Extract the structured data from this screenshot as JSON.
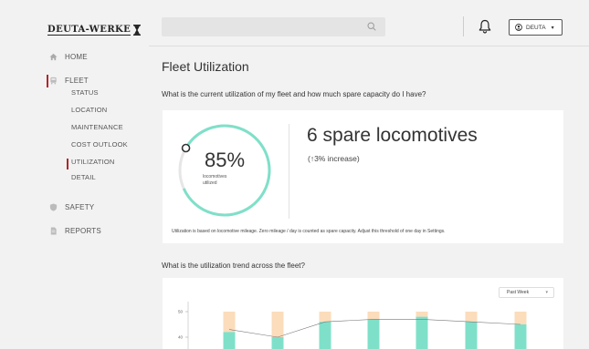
{
  "brand": {
    "name": "DEUTA-WERKE"
  },
  "nav": {
    "home": "HOME",
    "fleet": "FLEET",
    "fleet_sub": [
      "STATUS",
      "LOCATION",
      "MAINTENANCE",
      "COST OUTLOOK",
      "UTILIZATION",
      "DETAIL"
    ],
    "safety": "SAFETY",
    "reports": "REPORTS"
  },
  "topbar": {
    "search_placeholder": "",
    "user_label": "DEUTA"
  },
  "page": {
    "title": "Fleet Utilization",
    "question1": "What is the current utilization of my fleet and how much spare capacity do I have?",
    "utilization_pct": "85%",
    "utilization_value": 0.85,
    "utilization_caption": "locomotives utilized",
    "spare_headline": "6 spare locomotives",
    "spare_change": "(↑3% increase)",
    "note": "Utilization is based on locomotive mileage. Zero mileage / day is counted as spare capacity. Adjust this threshold of one day in Settings.",
    "question2": "What is the utilization trend across the fleet?",
    "period_select": "Past Week"
  },
  "colors": {
    "accent": "#b0262b",
    "teal": "#7fe0c9",
    "peach": "#fbdcbb",
    "gauge_track": "#e6e6e6"
  },
  "chart_data": {
    "type": "bar",
    "categories": [
      "",
      "",
      "",
      "",
      "",
      "",
      ""
    ],
    "series": [
      {
        "values": [
          42,
          40,
          46,
          47,
          48,
          46,
          45
        ]
      },
      {
        "values": [
          8,
          10,
          4,
          3,
          2,
          4,
          5
        ]
      }
    ],
    "line_values": [
      43,
      40,
      46,
      47,
      47,
      46,
      45
    ],
    "yticks": [
      50,
      40
    ],
    "ylim": [
      35,
      55
    ],
    "stacked": true,
    "grid": false
  }
}
